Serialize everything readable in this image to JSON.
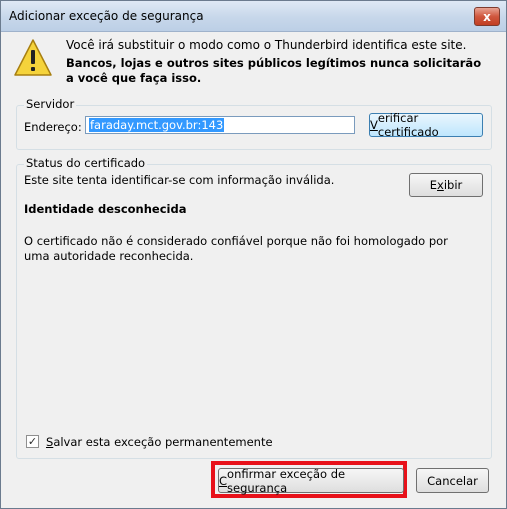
{
  "window": {
    "title": "Adicionar exceção de segurança",
    "close_glyph": "x"
  },
  "warning": {
    "icon": "warning-icon",
    "line1": "Você irá substituir o modo como o Thunderbird identifica este site.",
    "line2": "Bancos, lojas e outros sites públicos legítimos nunca solicitarão a você que faça isso."
  },
  "server": {
    "group_label": "Servidor",
    "address_label": "Endereço:",
    "address_value": "faraday.mct.gov.br:143",
    "verify_button_pre": "",
    "verify_button_accel": "V",
    "verify_button_post": "erificar certificado"
  },
  "status": {
    "group_label": "Status do certificado",
    "message": "Este site tenta identificar-se com informação inválida.",
    "view_button_pre": "E",
    "view_button_accel": "x",
    "view_button_post": "ibir",
    "identity": "Identidade desconhecida",
    "description": "O certificado não é considerado confiável porque não foi homologado por uma autoridade reconhecida.",
    "permanent_checkbox_checked": true,
    "permanent_checkbox_glyph": "✓",
    "permanent_label_accel": "S",
    "permanent_label_rest": "alvar esta exceção permanentemente"
  },
  "footer": {
    "confirm_accel": "C",
    "confirm_rest": "onfirmar exceção de segurança",
    "cancel_label": "Cancelar"
  },
  "colors": {
    "highlight": "#e8111a",
    "selection": "#3399ff"
  }
}
